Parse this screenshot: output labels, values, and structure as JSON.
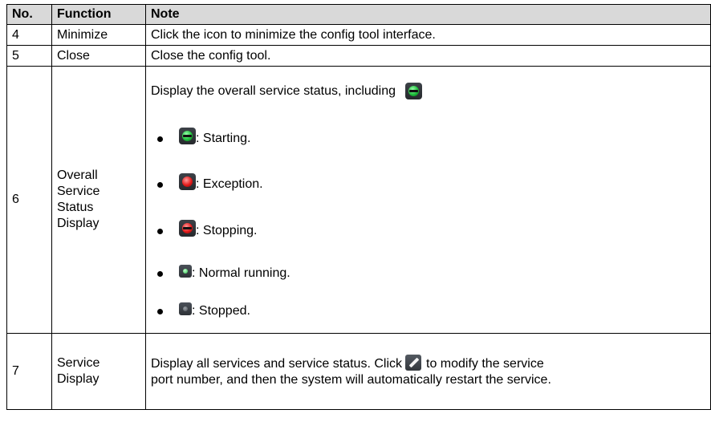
{
  "headers": {
    "no": "No.",
    "function": "Function",
    "note": "Note"
  },
  "rows": [
    {
      "no": "4",
      "function": "Minimize",
      "note": "Click the icon to minimize the config tool interface."
    },
    {
      "no": "5",
      "function": "Close",
      "note": "Close the config tool."
    },
    {
      "no": "6",
      "function_lines": [
        "Overall",
        "Service",
        "Status",
        "Display"
      ],
      "intro": "Display the overall service status, including",
      "items": [
        {
          "icon": "starting-status-icon",
          "text": ": Starting."
        },
        {
          "icon": "exception-status-icon",
          "text": ": Exception."
        },
        {
          "icon": "stopping-status-icon",
          "text": ": Stopping."
        },
        {
          "icon": "normal-running-icon",
          "text": ": Normal running."
        },
        {
          "icon": "stopped-icon",
          "text": ": Stopped."
        }
      ]
    },
    {
      "no": "7",
      "function_lines": [
        "Service",
        "Display"
      ],
      "note_part1": "Display all services and service status. Click",
      "note_icon": "pencil-edit-icon",
      "note_part2": "to modify the service",
      "note_line2": "port number, and then the system will automatically restart the service."
    }
  ],
  "colors": {
    "header_bg": "#d9d9d9",
    "green_status": "#1fbf3c",
    "red_status": "#e21b1b"
  }
}
